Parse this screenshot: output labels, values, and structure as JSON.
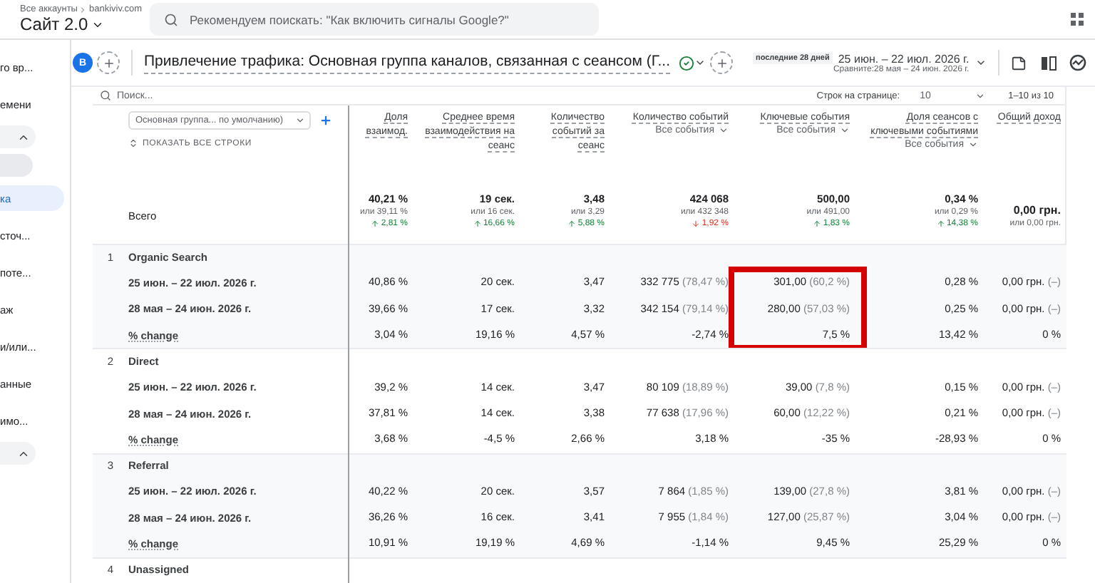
{
  "topbar": {
    "breadcrumb": [
      "Все аккаунты",
      "bankiviv.com"
    ],
    "property": "Сайт 2.0",
    "search_placeholder": "Рекомендуем поискать: \"Как включить сигналы Google?\""
  },
  "sidebar": {
    "items": [
      {
        "kind": "link",
        "label": "го вр...",
        "selected": false
      },
      {
        "kind": "link",
        "label": "емени",
        "selected": false
      },
      {
        "kind": "section",
        "expanded": true
      },
      {
        "kind": "blank"
      },
      {
        "kind": "link",
        "label": "ка",
        "selected": true
      },
      {
        "kind": "link",
        "label": "сточ...",
        "selected": false
      },
      {
        "kind": "link",
        "label": "поте...",
        "selected": false
      },
      {
        "kind": "link",
        "label": "аж",
        "selected": false
      },
      {
        "kind": "link",
        "label": "и/или...",
        "selected": false
      },
      {
        "kind": "link",
        "label": "анные",
        "selected": false
      },
      {
        "kind": "link",
        "label": "имо...",
        "selected": false
      },
      {
        "kind": "section",
        "expanded": true
      }
    ]
  },
  "report": {
    "segment_letter": "B",
    "title": "Привлечение трафика: Основная группа каналов, связанная с сеансом (Г...",
    "date_chip": "последние 28 дней",
    "date_range": "25 июн. – 22 июл. 2026 г.",
    "compare_range": "Сравните:28 мая – 24 июн. 2026 г."
  },
  "table": {
    "search_placeholder": "Поиск...",
    "rows_per_page_label": "Строк на странице:",
    "rows_per_page": "10",
    "pagination": "1–10 из 10",
    "dimension": "Основная группа... по умолчанию)",
    "show_all": "ПОКАЗАТЬ ВСЕ СТРОКИ",
    "columns": [
      {
        "label": "Доля взаимод."
      },
      {
        "label": "Среднее время взаимодействия на сеанс"
      },
      {
        "label": "Количество событий за сеанс"
      },
      {
        "label": "Количество событий",
        "filter": "Все события"
      },
      {
        "label": "Ключевые события",
        "filter": "Все события"
      },
      {
        "label": "Доля сеансов с ключевыми событиями",
        "filter": "Все события"
      },
      {
        "label": "Общий доход"
      }
    ],
    "totals_label": "Всего",
    "totals": [
      {
        "value": "40,21 %",
        "previous": "или 39,11 %",
        "change": "2,81 %",
        "increase": true
      },
      {
        "value": "19 сек.",
        "previous": "или 16 сек.",
        "change": "16,66 %",
        "increase": true
      },
      {
        "value": "3,48",
        "previous": "или 3,29",
        "change": "5,88 %",
        "increase": true
      },
      {
        "value": "424 068",
        "previous": "или 432 348",
        "change": "1,92 %",
        "increase": false
      },
      {
        "value": "500,00",
        "previous": "или 491,00",
        "change": "1,83 %",
        "increase": true
      },
      {
        "value": "0,34 %",
        "previous": "или 0,29 %",
        "change": "14,38 %",
        "increase": true
      },
      {
        "value": "0,00 грн.",
        "previous": "или 0,00 грн."
      }
    ],
    "groups": [
      {
        "index": "1",
        "name": "Organic Search",
        "rows": [
          {
            "kind": "period",
            "label": "25 июн. – 22 июл. 2026 г.",
            "cells": [
              "40,86 %",
              "20 сек.",
              "3,47",
              "332 775 (78,47 %)",
              {
                "text": "301,00 (60,2 %)",
                "framed": true
              },
              "0,28 %",
              "0,00 грн. (–)"
            ]
          },
          {
            "kind": "period",
            "label": "28 мая – 24 июн. 2026 г.",
            "cells": [
              "39,66 %",
              "17 сек.",
              "3,32",
              "342 154 (79,14 %)",
              {
                "text": "280,00 (57,03 %)",
                "framed": true
              },
              "0,25 %",
              "0,00 грн. (–)"
            ]
          },
          {
            "kind": "change",
            "label": "% change",
            "cells": [
              "3,04 %",
              "19,16 %",
              "4,57 %",
              "-2,74 %",
              {
                "text": "7,5 %",
                "framed": true
              },
              "13,42 %",
              "0 %"
            ]
          }
        ]
      },
      {
        "index": "2",
        "name": "Direct",
        "rows": [
          {
            "kind": "period",
            "label": "25 июн. – 22 июл. 2026 г.",
            "cells": [
              "39,2 %",
              "14 сек.",
              "3,47",
              "80 109 (18,89 %)",
              "39,00 (7,8 %)",
              "0,15 %",
              "0,00 грн. (–)"
            ]
          },
          {
            "kind": "period",
            "label": "28 мая – 24 июн. 2026 г.",
            "cells": [
              "37,81 %",
              "14 сек.",
              "3,38",
              "77 638 (17,96 %)",
              "60,00 (12,22 %)",
              "0,21 %",
              "0,00 грн. (–)"
            ]
          },
          {
            "kind": "change",
            "label": "% change",
            "cells": [
              "3,68 %",
              "-4,5 %",
              "2,66 %",
              "3,18 %",
              "-35 %",
              "-28,93 %",
              "0 %"
            ]
          }
        ]
      },
      {
        "index": "3",
        "name": "Referral",
        "rows": [
          {
            "kind": "period",
            "label": "25 июн. – 22 июл. 2026 г.",
            "cells": [
              "40,22 %",
              "20 сек.",
              "3,57",
              "7 864 (1,85 %)",
              "139,00 (27,8 %)",
              "3,81 %",
              "0,00 грн. (–)"
            ]
          },
          {
            "kind": "period",
            "label": "28 мая – 24 июн. 2026 г.",
            "cells": [
              "36,26 %",
              "16 сек.",
              "3,41",
              "7 955 (1,84 %)",
              "127,00 (25,87 %)",
              "3,04 %",
              "0,00 грн. (–)"
            ]
          },
          {
            "kind": "change",
            "label": "% change",
            "cells": [
              "10,91 %",
              "19,19 %",
              "4,69 %",
              "-1,14 %",
              "9,45 %",
              "25,29 %",
              "0 %"
            ]
          }
        ]
      },
      {
        "index": "4",
        "name": "Unassigned"
      }
    ]
  }
}
